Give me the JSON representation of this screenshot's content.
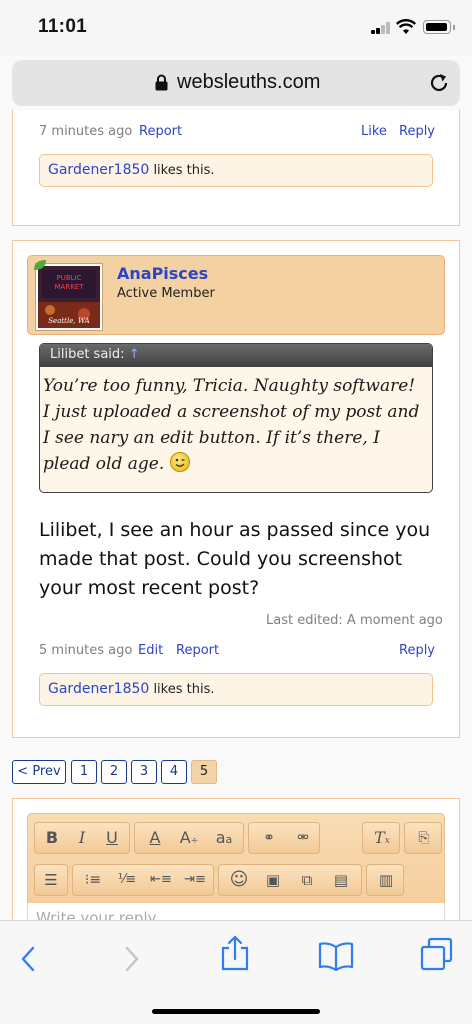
{
  "status": {
    "time": "11:01"
  },
  "browser": {
    "url": "websleuths.com"
  },
  "prev_post": {
    "time": "7 minutes ago",
    "report": "Report",
    "like": "Like",
    "reply": "Reply",
    "likes_user": "Gardener1850",
    "likes_text": " likes this."
  },
  "post": {
    "username": "AnaPisces",
    "user_title": "Active Member",
    "avatar_text": [
      "PUBLIC",
      "MARKET",
      "Seattle, WA"
    ],
    "quote": {
      "author": "Lilibet said: ",
      "arrow": "↑",
      "text": "You’re too funny, Tricia. Naughty software! I just uploaded a screenshot of my post and I see nary an edit button. If it’s there, I plead old age."
    },
    "message": "Lilibet, I see an hour as passed since you made that post. Could you screenshot your most recent post?",
    "last_edited": "Last edited: A moment ago",
    "time": "5 minutes ago",
    "edit": "Edit",
    "report": "Report",
    "reply": "Reply",
    "likes_user": "Gardener1850",
    "likes_text": " likes this."
  },
  "pagination": {
    "prev": "< Prev",
    "pages": [
      "1",
      "2",
      "3",
      "4",
      "5"
    ],
    "current": "5"
  },
  "editor": {
    "placeholder": "Write your reply..."
  }
}
